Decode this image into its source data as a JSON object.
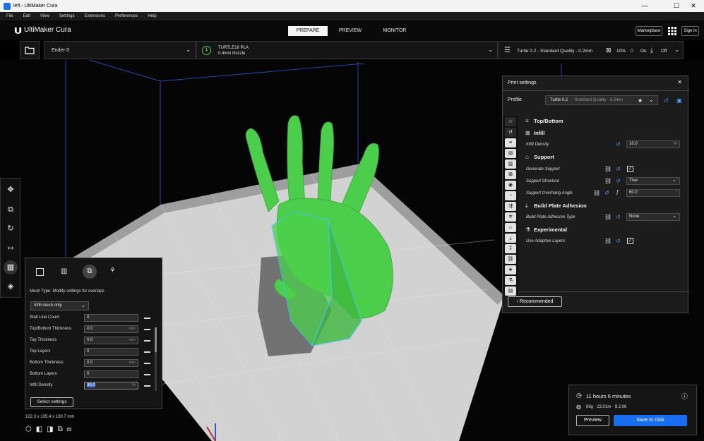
{
  "window": {
    "title": "left - UltiMaker Cura",
    "min": "—",
    "max": "☐",
    "close": "✕"
  },
  "menu": [
    "File",
    "Edit",
    "View",
    "Settings",
    "Extensions",
    "Preferences",
    "Help"
  ],
  "header": {
    "app_name": "UltiMaker Cura",
    "tabs": [
      "PREPARE",
      "PREVIEW",
      "MONITOR"
    ],
    "active_tab": "PREPARE",
    "marketplace": "Marketplace",
    "signin": "Sign in"
  },
  "toolbar": {
    "printer": "Ender-3",
    "material_line1": "TURTLE16 PLA",
    "material_line2": "0.4mm Nozzle",
    "extruder_number": "1",
    "profile_summary": "Turtle 0.2 - Standard Quality - 0.2mm",
    "infill_pct": "10%",
    "support": "On",
    "adhesion": "Off"
  },
  "print_settings": {
    "title": "Print settings",
    "profile_label": "Profile",
    "profile_value": "Turtle 0.2",
    "profile_value_detail": "- Standard Quality - 0.2mm",
    "sections": {
      "topbottom": "Top/Bottom",
      "infill": "Infill",
      "support": "Support",
      "adhesion": "Build Plate Adhesion",
      "experimental": "Experimental"
    },
    "settings": {
      "infill_density_label": "Infill Density",
      "infill_density_value": "10.0",
      "infill_density_unit": "%",
      "generate_support_label": "Generate Support",
      "support_structure_label": "Support Structure",
      "support_structure_value": "Tree",
      "overhang_label": "Support Overhang Angle",
      "overhang_value": "60.0",
      "overhang_unit": "°",
      "adhesion_type_label": "Build Plate Adhesion Type",
      "adhesion_type_value": "None",
      "adaptive_layers_label": "Use Adaptive Layers"
    },
    "recommended": "Recommended"
  },
  "mesh_panel": {
    "mesh_type_label": "Mesh Type: Modify settings for overlaps",
    "dropdown": "Infill mesh only",
    "rows": [
      {
        "label": "Wall Line Count",
        "value": "0",
        "unit": ""
      },
      {
        "label": "Top/Bottom Thickness",
        "value": "0.0",
        "unit": "mm"
      },
      {
        "label": "Top Thickness",
        "value": "0.0",
        "unit": "mm"
      },
      {
        "label": "Top Layers",
        "value": "0",
        "unit": ""
      },
      {
        "label": "Bottom Thickness",
        "value": "0.0",
        "unit": "mm"
      },
      {
        "label": "Bottom Layers",
        "value": "0",
        "unit": ""
      },
      {
        "label": "Infill Density",
        "value": "30.0",
        "unit": "%"
      }
    ],
    "select_settings": "Select settings"
  },
  "dimensions": "122.3 x 135.4 x 130.7 mm",
  "estimate": {
    "time": "11 hours 6 minutes",
    "material": "69g · 23.01m · $ 2.06",
    "preview_btn": "Preview",
    "save_btn": "Save to Disk"
  },
  "colors": {
    "accent": "#196ef0",
    "model": "#4ccd4c",
    "plate": "#c8c8c8",
    "selection": "#3cc8f0"
  }
}
